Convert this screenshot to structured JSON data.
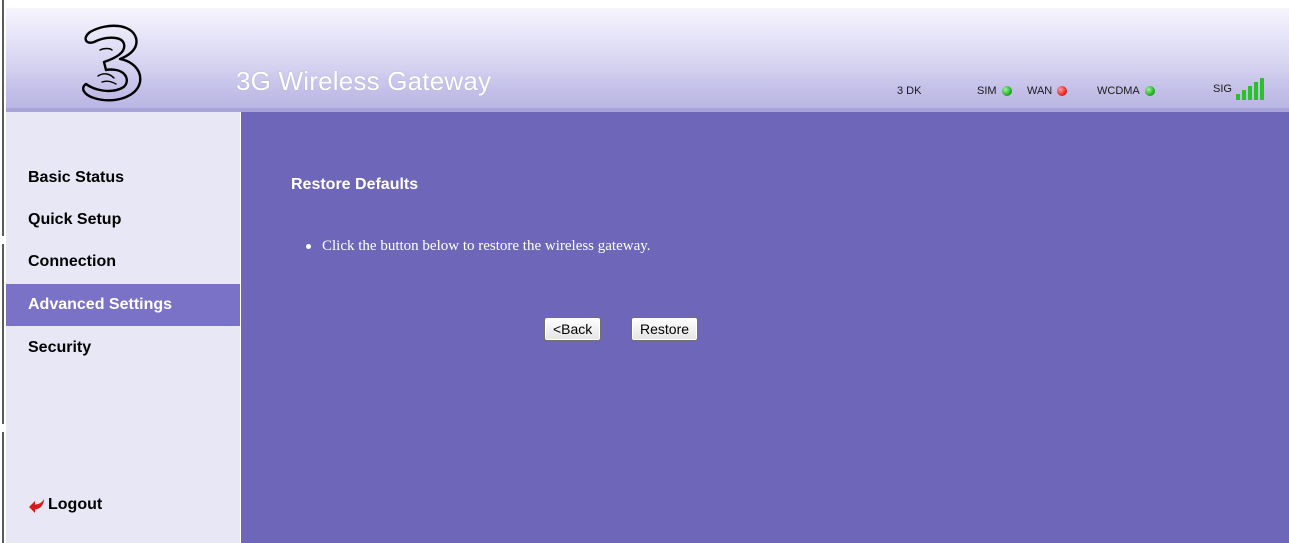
{
  "header": {
    "app_title": "3G Wireless Gateway",
    "carrier": "3 DK",
    "indicators": [
      {
        "label": "SIM",
        "status_color": "#16a316"
      },
      {
        "label": "WAN",
        "status_color": "#e01818"
      },
      {
        "label": "WCDMA",
        "status_color": "#16a316"
      }
    ],
    "signal": {
      "label": "SIG",
      "bars": 5,
      "max_bars": 5,
      "color": "#27c427"
    }
  },
  "sidebar": {
    "items": [
      {
        "label": "Basic Status"
      },
      {
        "label": "Quick Setup"
      },
      {
        "label": "Connection"
      },
      {
        "label": "Advanced Settings",
        "active": true
      },
      {
        "label": "Security"
      }
    ],
    "logout_label": "Logout"
  },
  "main": {
    "title": "Restore Defaults",
    "instruction": "Click the button below to restore the wireless gateway.",
    "back_button": "<Back",
    "restore_button": "Restore"
  },
  "colors": {
    "main_background": "#6d66b9",
    "sidebar_background": "#e8e7f6",
    "active_nav": "#7a72c6"
  }
}
